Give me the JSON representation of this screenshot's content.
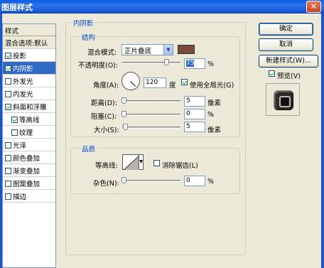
{
  "window": {
    "title": "图层样式",
    "close_glyph": "✕"
  },
  "sidebar": {
    "header": "样式",
    "items": [
      {
        "label": "混合选项:默认",
        "checkbox": false,
        "checked": false,
        "selected": false
      },
      {
        "label": "投影",
        "checkbox": true,
        "checked": true,
        "selected": false
      },
      {
        "label": "内阴影",
        "checkbox": true,
        "checked": true,
        "selected": true
      },
      {
        "label": "外发光",
        "checkbox": true,
        "checked": false,
        "selected": false
      },
      {
        "label": "内发光",
        "checkbox": true,
        "checked": false,
        "selected": false
      },
      {
        "label": "斜面和浮雕",
        "checkbox": true,
        "checked": true,
        "selected": false
      },
      {
        "label": "等高线",
        "checkbox": true,
        "checked": true,
        "selected": false
      },
      {
        "label": "纹理",
        "checkbox": true,
        "checked": false,
        "selected": false
      },
      {
        "label": "光泽",
        "checkbox": true,
        "checked": false,
        "selected": false
      },
      {
        "label": "颜色叠加",
        "checkbox": true,
        "checked": false,
        "selected": false
      },
      {
        "label": "渐变叠加",
        "checkbox": true,
        "checked": false,
        "selected": false
      },
      {
        "label": "图案叠加",
        "checkbox": true,
        "checked": false,
        "selected": false
      },
      {
        "label": "描边",
        "checkbox": true,
        "checked": false,
        "selected": false
      }
    ]
  },
  "inner_shadow": {
    "section_title": "内阴影",
    "structure": {
      "title": "结构",
      "blend_mode_label": "混合模式:",
      "blend_mode_value": "正片叠底",
      "shadow_color": "#7a4a3a",
      "opacity_label": "不透明度(O):",
      "opacity_value": "75",
      "opacity_fraction": 0.75,
      "opacity_unit": "%",
      "angle_label": "角度(A):",
      "angle_value": "120",
      "angle_unit": "度",
      "global_light_label": "使用全局光(G)",
      "global_light_checked": true,
      "distance_label": "距离(D):",
      "distance_value": "5",
      "distance_unit": "像素",
      "choke_label": "阻塞(C):",
      "choke_value": "0",
      "choke_unit": "%",
      "size_label": "大小(S):",
      "size_value": "5",
      "size_unit": "像素"
    },
    "quality": {
      "title": "品质",
      "contour_label": "等高线:",
      "anti_alias_label": "消除锯齿(L)",
      "anti_alias_checked": false,
      "noise_label": "杂色(N):",
      "noise_value": "0",
      "noise_unit": "%"
    }
  },
  "buttons": {
    "ok": "确定",
    "cancel": "取消",
    "new_style": "新建样式(W)...",
    "preview_label": "预览(V)",
    "preview_checked": true
  },
  "colors": {
    "accent": "#316ac5",
    "group_title": "#0046d5",
    "titlebar": "#0a5fe4"
  }
}
